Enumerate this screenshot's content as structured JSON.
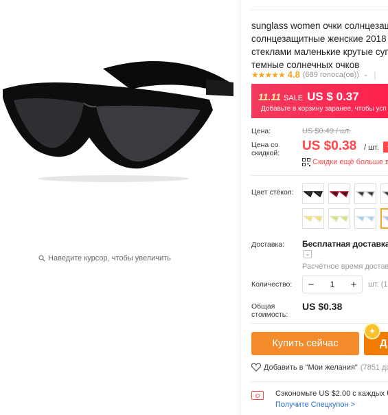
{
  "gallery": {
    "zoom_hint": "Наведите курсор, чтобы увеличить",
    "zoom_icon": "magnifier-icon"
  },
  "product": {
    "title_lines": [
      "sunglass women очки солнцезащ",
      "солнцезащитные женские 2018",
      "стеклами маленькие крутые суп",
      "темные солнечных очков"
    ],
    "rating": {
      "stars": "★★★★★",
      "value": "4.8",
      "votes": "(689 голоса(ов))",
      "chevron": "⌄",
      "separator": "|"
    }
  },
  "sale": {
    "event": "11.11",
    "word": "SALE",
    "price": "US $ 0.37",
    "subtitle": "Добавьте в корзину заранее, чтобы усп",
    "bg_color": "#f23a5e"
  },
  "pricing": {
    "price_label": "Цена:",
    "old_price": "US $0.49 / шт.",
    "discount_label": "Цена со скидкой:",
    "new_price": "US $0.38",
    "unit": "/ шт.",
    "badge": "-2",
    "qr_text": "Скидки ещё больше в",
    "accent_color": "#ff4747"
  },
  "options": {
    "color_label": "Цвет стёкол:",
    "swatches": [
      {
        "name": "black",
        "frame": "#111111",
        "lens": "#333333"
      },
      {
        "name": "red",
        "frame": "#b3122f",
        "lens": "#3a1a1a"
      },
      {
        "name": "white",
        "frame": "#f5f5f5",
        "lens": "#333333"
      },
      {
        "name": "cream-yellow",
        "frame": "#f3efd8",
        "lens": "#f3e26b"
      },
      {
        "name": "cream-green",
        "frame": "#f1f0dc",
        "lens": "#cfe57a"
      },
      {
        "name": "clear-blue",
        "frame": "#eef4fb",
        "lens": "#a7cdef"
      },
      {
        "name": "partial",
        "frame": "#e8e8e8",
        "lens": "#f5a623"
      }
    ]
  },
  "shipping": {
    "label": "Доставка:",
    "value": "Бесплатная доставка в",
    "time": "Расчётное время доставк"
  },
  "quantity": {
    "label": "Количество:",
    "minus": "−",
    "value": "1",
    "plus": "+",
    "unit": "шт. (1"
  },
  "total": {
    "label": "Общая стоимость:",
    "value": "US $0.38"
  },
  "actions": {
    "buy_label": "Купить сейчас",
    "cart_label": "Д",
    "coin_symbol": "✦",
    "buy_color": "#f48b2a"
  },
  "wishlist": {
    "label": "Добавить в \"Мои желания\"",
    "count": "(7851 до"
  },
  "coupon": {
    "text": "Сэкономьте US $2.00 с каждых US",
    "link": "Получите Спецкупон >"
  }
}
